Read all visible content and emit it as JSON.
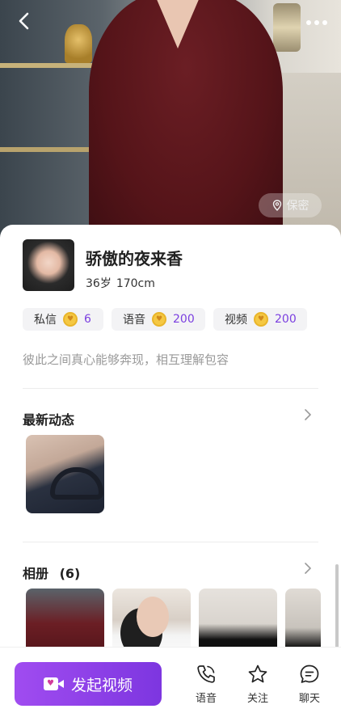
{
  "nav": {
    "back_icon": "chevron-left-icon",
    "more_icon": "more-dots-icon"
  },
  "hero": {
    "location_label": "保密"
  },
  "profile": {
    "name": "骄傲的夜来香",
    "age": "36岁",
    "height": "170cm",
    "bio": "彼此之间真心能够奔现，相互理解包容"
  },
  "prices": [
    {
      "label": "私信",
      "value": "6"
    },
    {
      "label": "语音",
      "value": "200"
    },
    {
      "label": "视频",
      "value": "200"
    }
  ],
  "moments": {
    "title": "最新动态"
  },
  "album": {
    "title": "相册",
    "count": "(6)"
  },
  "bottom": {
    "video_button": "发起视频",
    "voice": "语音",
    "follow": "关注",
    "chat": "聊天"
  },
  "colors": {
    "accent": "#8b3ee8",
    "coin": "#f5c843"
  }
}
